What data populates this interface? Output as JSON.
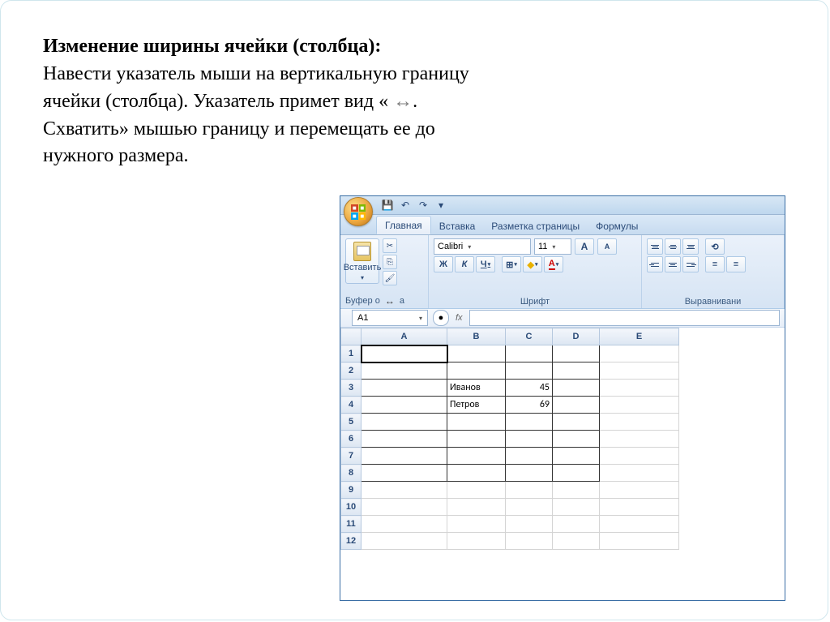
{
  "instruction": {
    "title": "Изменение ширины ячейки (столбца):",
    "line1": "Навести указатель мыши на вертикальную границу",
    "line2": "ячейки (столбца). Указатель примет вид    «",
    "cursor_glyph": "↔",
    "line2_end": ".",
    "line3": "Схватить» мышью границу и перемещать ее до",
    "line4": "нужного размера."
  },
  "excel": {
    "qat": {
      "save": "💾",
      "undo": "↶",
      "redo": "↷"
    },
    "tabs": [
      "Главная",
      "Вставка",
      "Разметка страницы",
      "Формулы"
    ],
    "active_tab_index": 0,
    "ribbon": {
      "paste_label": "Вставить",
      "clipboard_group": "Буфер о",
      "resize_glyph": "↔",
      "clipboard_group_suffix": "а",
      "font_group": "Шрифт",
      "align_group": "Выравнивани",
      "font_name": "Calibri",
      "font_size": "11",
      "increase": "A",
      "decrease": "A",
      "bold": "Ж",
      "italic": "К",
      "underline": "Ч",
      "border": "⊞",
      "fill": "◆",
      "font_color": "A"
    },
    "namebox": {
      "cell": "A1",
      "fx": "fx"
    },
    "columns": [
      "A",
      "B",
      "C",
      "D",
      "E"
    ],
    "rows": [
      1,
      2,
      3,
      4,
      5,
      6,
      7,
      8,
      9,
      10,
      11,
      12
    ],
    "data": {
      "B3": "Иванов",
      "C3": "45",
      "B4": "Петров",
      "C4": "69"
    },
    "boxed_rows_start": 1,
    "boxed_rows_end": 8,
    "boxed_cols": [
      "A",
      "B",
      "C",
      "D"
    ]
  }
}
